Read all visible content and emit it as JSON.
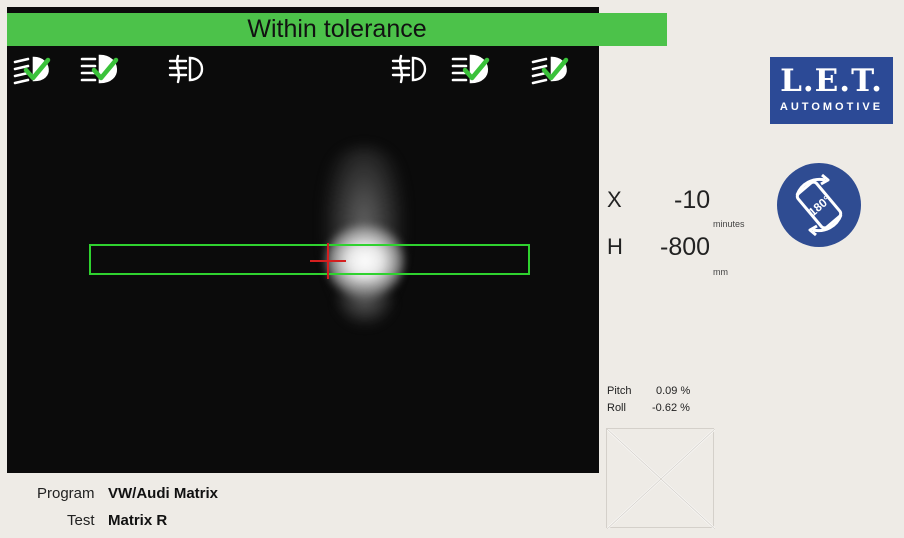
{
  "status": {
    "text": "Within tolerance",
    "color": "#4cc24a"
  },
  "lamp_icons": [
    {
      "name": "low-beam-icon",
      "checked": true
    },
    {
      "name": "high-beam-icon",
      "checked": true
    },
    {
      "name": "fog-light-icon",
      "checked": false
    },
    {
      "name": "fog-light-icon",
      "checked": false
    },
    {
      "name": "high-beam-icon",
      "checked": true
    },
    {
      "name": "low-beam-icon",
      "checked": true
    }
  ],
  "logo": {
    "brand": "L.E.T.",
    "sub": "AUTOMOTIVE"
  },
  "readout": {
    "x_label": "X",
    "x_value": "-10",
    "x_unit": "minutes",
    "h_label": "H",
    "h_value": "-800",
    "h_unit": "mm"
  },
  "rotate_button": {
    "label": "180°"
  },
  "tilt": {
    "pitch_label": "Pitch",
    "pitch_value": "0.09 %",
    "roll_label": "Roll",
    "roll_value": "-0.62 %"
  },
  "info": {
    "program_label": "Program",
    "program_value": "VW/Audi Matrix",
    "test_label": "Test",
    "test_value": "Matrix R"
  },
  "colors": {
    "accent_green": "#2fd22f",
    "crosshair": "#d41f1f",
    "brand_blue": "#2c4a96"
  }
}
